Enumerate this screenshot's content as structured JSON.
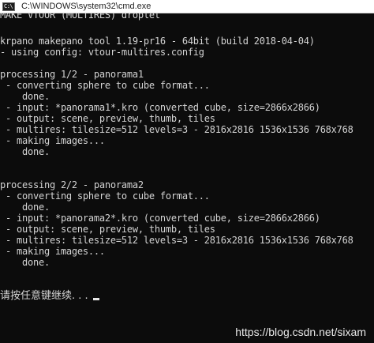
{
  "window": {
    "title": "C:\\WINDOWS\\system32\\cmd.exe",
    "icon": "cmd-console-icon"
  },
  "console": {
    "lines": [
      "MAKE VTOUR (MULTIRES) droplet",
      "",
      "krpano makepano tool 1.19-pr16 - 64bit (build 2018-04-04)",
      "- using config: vtour-multires.config",
      "",
      "processing 1/2 - panorama1",
      " - converting sphere to cube format...",
      "    done.",
      " - input: *panorama1*.kro (converted cube, size=2866x2866)",
      " - output: scene, preview, thumb, tiles",
      " - multires: tilesize=512 levels=3 - 2816x2816 1536x1536 768x768",
      " - making images...",
      "    done.",
      "",
      "",
      "processing 2/2 - panorama2",
      " - converting sphere to cube format...",
      "    done.",
      " - input: *panorama2*.kro (converted cube, size=2866x2866)",
      " - output: scene, preview, thumb, tiles",
      " - multires: tilesize=512 levels=3 - 2816x2816 1536x1536 768x768",
      " - making images...",
      "    done.",
      ""
    ],
    "prompt": "请按任意键继续. . . ",
    "text_color": "#d4d4d4",
    "background_color": "#0c0c0c"
  },
  "watermark": "https://blog.csdn.net/sixam"
}
